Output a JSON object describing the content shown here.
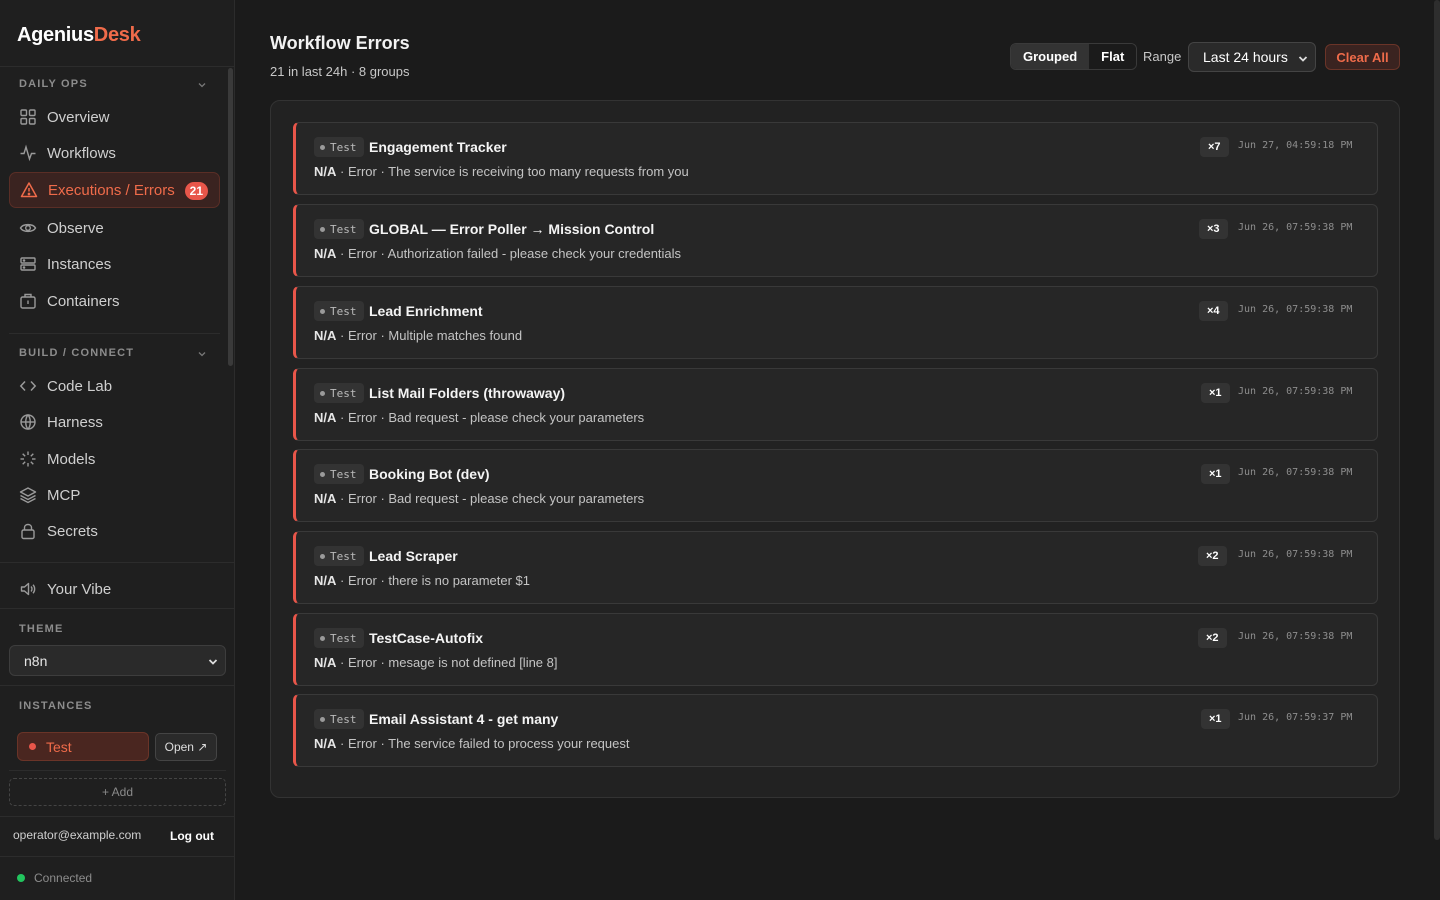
{
  "brand": {
    "part1": "Agenius",
    "part2": "Desk"
  },
  "sidebar": {
    "daily_ops_label": "DAILY OPS",
    "daily_ops": [
      {
        "label": "Overview",
        "icon": "grid-icon"
      },
      {
        "label": "Workflows",
        "icon": "activity-icon"
      },
      {
        "label": "Executions / Errors",
        "icon": "alert-triangle-icon",
        "badge": "21",
        "active": true
      },
      {
        "label": "Observe",
        "icon": "eye-icon"
      },
      {
        "label": "Instances",
        "icon": "server-icon"
      },
      {
        "label": "Containers",
        "icon": "container-icon"
      }
    ],
    "build_label": "BUILD / CONNECT",
    "build": [
      {
        "label": "Code Lab",
        "icon": "code-icon"
      },
      {
        "label": "Harness",
        "icon": "globe-icon"
      },
      {
        "label": "Models",
        "icon": "sparkle-icon"
      },
      {
        "label": "MCP",
        "icon": "layers-icon"
      },
      {
        "label": "Secrets",
        "icon": "lock-icon"
      }
    ],
    "vibe_label": "Your Vibe",
    "theme_label": "THEME",
    "theme_value": "n8n",
    "instances_label": "INSTANCES",
    "instance_name": "Test",
    "open_label": "Open ↗",
    "add_label": "+ Add",
    "user_email": "operator@example.com",
    "logout_label": "Log out",
    "status_text": "Connected"
  },
  "header": {
    "title": "Workflow Errors",
    "subtitle": "21 in last 24h · 8 groups",
    "grouped_label": "Grouped",
    "flat_label": "Flat",
    "range_label": "Range",
    "range_value": "Last 24 hours",
    "clear_label": "Clear All"
  },
  "colors": {
    "accent": "#ef6b4a",
    "error": "#e8564a",
    "ok": "#22c55e"
  },
  "errors": [
    {
      "tag": "Test",
      "name": "Engagement Tracker",
      "source": "N/A",
      "message": " · Error · The service is receiving too many requests from you",
      "count": "×7",
      "time": "Jun 27, 04:59:18 PM"
    },
    {
      "tag": "Test",
      "name": "GLOBAL — Error Poller → Mission Control",
      "source": "N/A",
      "message": " · Error · Authorization failed - please check your credentials",
      "count": "×3",
      "time": "Jun 26, 07:59:38 PM"
    },
    {
      "tag": "Test",
      "name": "Lead Enrichment",
      "source": "N/A",
      "message": " · Error · Multiple matches found",
      "count": "×4",
      "time": "Jun 26, 07:59:38 PM"
    },
    {
      "tag": "Test",
      "name": "List Mail Folders (throwaway)",
      "source": "N/A",
      "message": " · Error · Bad request - please check your parameters",
      "count": "×1",
      "time": "Jun 26, 07:59:38 PM"
    },
    {
      "tag": "Test",
      "name": "Booking Bot (dev)",
      "source": "N/A",
      "message": " · Error · Bad request - please check your parameters",
      "count": "×1",
      "time": "Jun 26, 07:59:38 PM"
    },
    {
      "tag": "Test",
      "name": "Lead Scraper",
      "source": "N/A",
      "message": " · Error · there is no parameter $1",
      "count": "×2",
      "time": "Jun 26, 07:59:38 PM"
    },
    {
      "tag": "Test",
      "name": "TestCase-Autofix",
      "source": "N/A",
      "message": " · Error · mesage is not defined [line 8]",
      "count": "×2",
      "time": "Jun 26, 07:59:38 PM"
    },
    {
      "tag": "Test",
      "name": "Email Assistant 4 - get many",
      "source": "N/A",
      "message": " · Error · The service failed to process your request",
      "count": "×1",
      "time": "Jun 26, 07:59:37 PM"
    }
  ]
}
